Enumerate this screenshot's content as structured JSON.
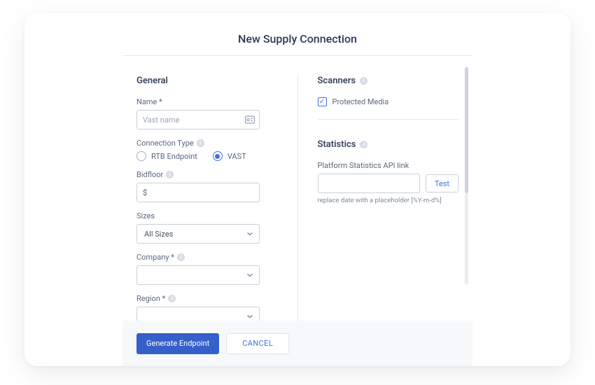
{
  "page_title": "New Supply Connection",
  "general": {
    "heading": "General",
    "name_label": "Name *",
    "name_placeholder": "Vast name",
    "connection_type_label": "Connection Type",
    "options": {
      "rtb": "RTB Endpoint",
      "vast": "VAST"
    },
    "selected_option": "vast",
    "bidfloor_label": "Bidfloor",
    "bidfloor_value": "$",
    "sizes_label": "Sizes",
    "sizes_value": "All Sizes",
    "company_label": "Company *",
    "company_value": "",
    "region_label": "Region *",
    "region_value": ""
  },
  "scanners": {
    "heading": "Scanners",
    "protected_media_label": "Protected Media",
    "protected_media_checked": true
  },
  "statistics": {
    "heading": "Statistics",
    "api_label": "Platform Statistics API link",
    "api_value": "",
    "test_label": "Test",
    "helper": "replace date with a placeholder [%Y-m-d%]"
  },
  "footer": {
    "generate": "Generate Endpoint",
    "cancel": "CANCEL"
  }
}
